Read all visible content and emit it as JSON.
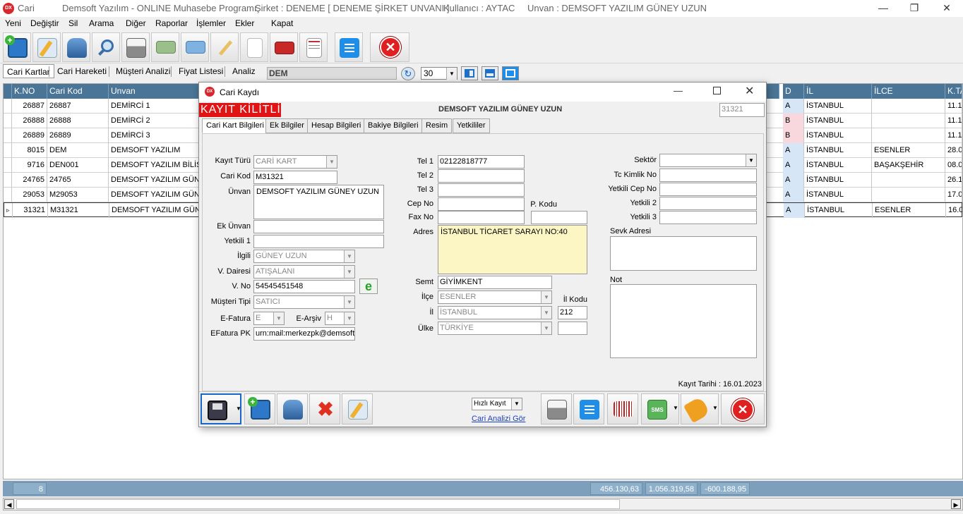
{
  "window": {
    "app": "Cari",
    "product": "Demsoft Yazılım - ONLINE Muhasebe Programı",
    "company": "Şirket : DENEME [ DENEME ŞİRKET UNVANI ]",
    "user": "Kullanıcı : AYTAC",
    "title": "Unvan : DEMSOFT YAZILIM GÜNEY UZUN",
    "logo": "DX"
  },
  "menu": [
    "Yeni",
    "Değiştir",
    "Sil",
    "Arama",
    "Diğer",
    "Raporlar",
    "İşlemler",
    "Ekler",
    "Kapat"
  ],
  "toolbar_icons": [
    "new-card-icon",
    "edit-icon",
    "delete-db-icon",
    "search-icon",
    "print-icon",
    "money-icon",
    "card-icon",
    "pen-icon",
    "blank-doc-icon",
    "toolbox-icon",
    "invoice-icon",
    "list-icon",
    "close-icon"
  ],
  "tabs": [
    "Cari Kartlar",
    "Cari Hareketi",
    "Müşteri Analizi",
    "Fiyat Listesi",
    "Analiz"
  ],
  "search": {
    "value": "DEM"
  },
  "page_size": "30",
  "grid": {
    "left_columns": [
      "K.NO",
      "Cari Kod",
      "Unvan"
    ],
    "right_columns": [
      "D",
      "İL",
      "İLCE",
      "K.TA"
    ],
    "rows": [
      {
        "kno": "26887",
        "kod": "26887",
        "unvan": "DEMİRCİ 1",
        "d": "A",
        "il": "İSTANBUL",
        "ilce": "",
        "kt": "11.1"
      },
      {
        "kno": "26888",
        "kod": "26888",
        "unvan": "DEMİRCİ 2",
        "d": "B",
        "il": "İSTANBUL",
        "ilce": "",
        "kt": "11.1"
      },
      {
        "kno": "26889",
        "kod": "26889",
        "unvan": "DEMİRCİ 3",
        "d": "B",
        "il": "İSTANBUL",
        "ilce": "",
        "kt": "11.1"
      },
      {
        "kno": "8015",
        "kod": "DEM",
        "unvan": "DEMSOFT YAZILIM",
        "d": "A",
        "il": "İSTANBUL",
        "ilce": "ESENLER",
        "kt": "28.0"
      },
      {
        "kno": "9716",
        "kod": "DEN001",
        "unvan": "DEMSOFT YAZILIM BİLİŞİM",
        "d": "A",
        "il": "İSTANBUL",
        "ilce": "BAŞAKŞEHİR",
        "kt": "08.0"
      },
      {
        "kno": "24765",
        "kod": "24765",
        "unvan": "DEMSOFT YAZILIM GÜNEY",
        "d": "A",
        "il": "İSTANBUL",
        "ilce": "",
        "kt": "26.1"
      },
      {
        "kno": "29053",
        "kod": "M29053",
        "unvan": "DEMSOFT YAZILIM GÜNEY",
        "d": "A",
        "il": "İSTANBUL",
        "ilce": "",
        "kt": "17.0"
      },
      {
        "kno": "31321",
        "kod": "M31321",
        "unvan": "DEMSOFT YAZILIM GÜNEY",
        "d": "A",
        "il": "İSTANBUL",
        "ilce": "ESENLER",
        "kt": "16.0"
      }
    ]
  },
  "footer": {
    "count": "8",
    "sum1": "456.130,63",
    "sum2": "1.056.319,58",
    "sum3": "-600.188,95"
  },
  "dialog": {
    "title": "Cari Kaydı",
    "locked": "KAYIT KİLİTLİ",
    "header_name": "DEMSOFT YAZILIM GÜNEY UZUN",
    "record_no": "31321",
    "tabs": [
      "Cari Kart Bilgileri",
      "Ek Bilgiler",
      "Hesap Bilgileri",
      "Bakiye Bilgileri",
      "Resim",
      "Yetkililer"
    ],
    "labels": {
      "kayit_turu": "Kayıt Türü",
      "cari_kod": "Cari Kod",
      "unvan": "Ünvan",
      "ek_unvan": "Ek Ünvan",
      "yetkili1": "Yetkili 1",
      "ilgili": "İlgili",
      "v_dairesi": "V. Dairesi",
      "v_no": "V. No",
      "musteri_tipi": "Müşteri Tipi",
      "efatura": "E-Fatura",
      "earsiv": "E-Arşiv",
      "efatura_pk": "EFatura PK",
      "tel1": "Tel 1",
      "tel2": "Tel 2",
      "tel3": "Tel 3",
      "cep": "Cep No",
      "pkodu": "P. Kodu",
      "fax": "Fax No",
      "adres": "Adres",
      "semt": "Semt",
      "ilce": "İlçe",
      "il": "İl",
      "ilkodu": "İl Kodu",
      "ulke": "Ülke",
      "sektor": "Sektör",
      "tckimlik": "Tc Kimlik No",
      "yetkili_cep": "Yetkili Cep No",
      "yetkili2": "Yetkili 2",
      "yetkili3": "Yetkili 3",
      "sevk": "Sevk Adresi",
      "not": "Not"
    },
    "values": {
      "kayit_turu": "CARİ KART",
      "cari_kod": "M31321",
      "unvan": "DEMSOFT YAZILIM GÜNEY UZUN",
      "ilgili": "GÜNEY UZUN",
      "v_dairesi": "ATIŞALANI",
      "v_no": "54545451548",
      "musteri_tipi": "SATICI",
      "efatura": "E",
      "earsiv": "H",
      "efatura_pk": "urn:mail:merkezpk@demsofty",
      "tel1": "02122818777",
      "adres": "İSTANBUL TİCARET SARAYI NO:40",
      "semt": "GİYİMKENT",
      "ilce": "ESENLER",
      "il": "İSTANBUL",
      "ilkodu": "212",
      "ulke": "TÜRKİYE"
    },
    "kayit_tarihi": "Kayıt Tarihi : 16.01.2023",
    "quick_save": "Hızlı Kayıt",
    "analysis_link": "Cari Analizi Gör"
  }
}
